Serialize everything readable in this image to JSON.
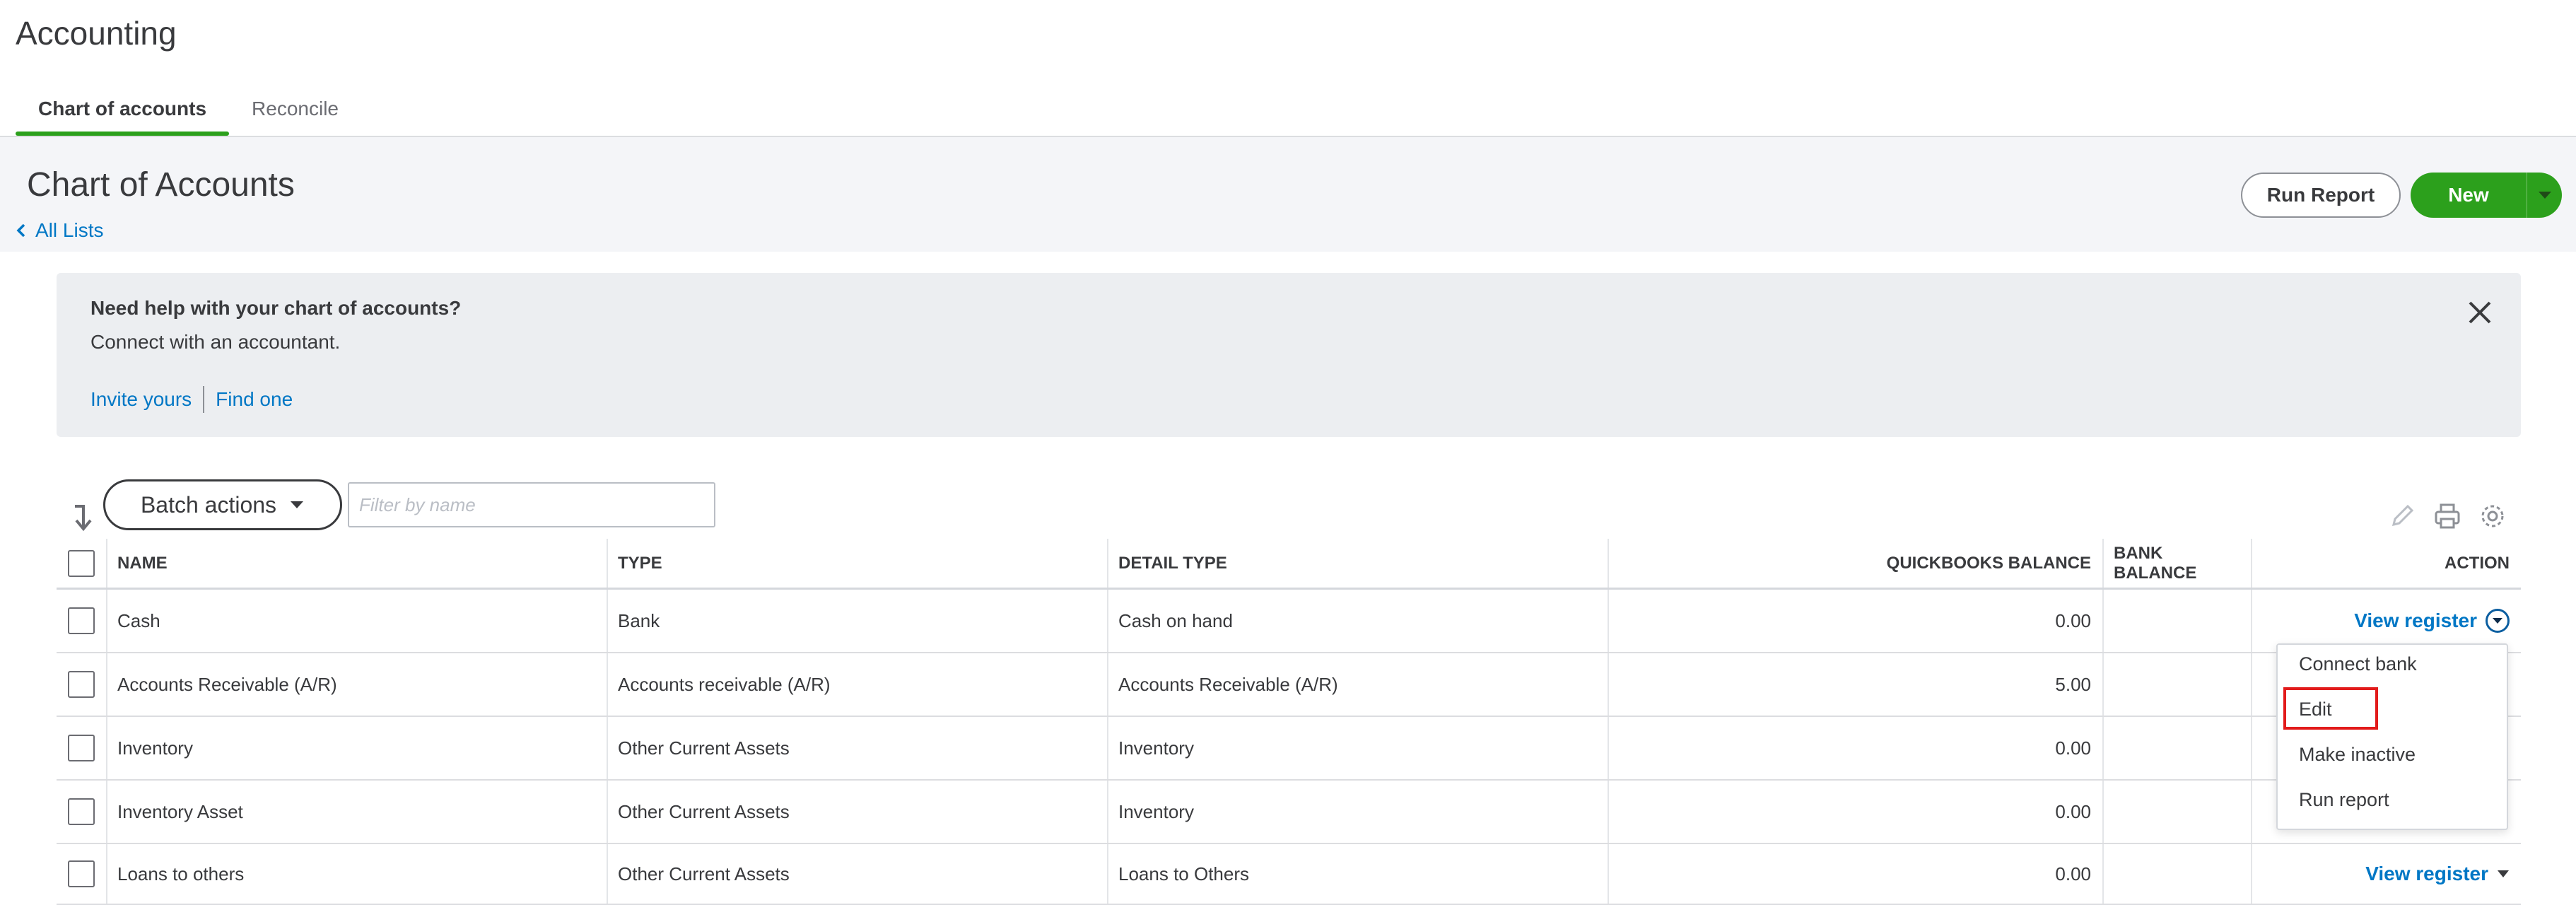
{
  "app": {
    "title": "Accounting"
  },
  "tabs": [
    {
      "label": "Chart of accounts",
      "active": true
    },
    {
      "label": "Reconcile",
      "active": false
    }
  ],
  "header": {
    "title": "Chart of Accounts",
    "back_link": "All Lists",
    "run_report_label": "Run Report",
    "new_label": "New"
  },
  "help": {
    "title": "Need help with your chart of accounts?",
    "subtitle": "Connect with an accountant.",
    "link_invite": "Invite yours",
    "link_find": "Find one"
  },
  "toolbar": {
    "batch_label": "Batch actions",
    "filter_placeholder": "Filter by name"
  },
  "table": {
    "columns": {
      "name": "NAME",
      "type": "TYPE",
      "detail_type": "DETAIL TYPE",
      "qb_balance": "QUICKBOOKS BALANCE",
      "bank_balance": "BANK BALANCE",
      "action": "ACTION"
    },
    "rows": [
      {
        "name": "Cash",
        "type": "Bank",
        "detail": "Cash on hand",
        "qb_balance": "0.00",
        "bank_balance": "",
        "action": "View register"
      },
      {
        "name": "Accounts Receivable (A/R)",
        "type": "Accounts receivable (A/R)",
        "detail": "Accounts Receivable (A/R)",
        "qb_balance": "5.00",
        "bank_balance": "",
        "action": ""
      },
      {
        "name": "Inventory",
        "type": "Other Current Assets",
        "detail": "Inventory",
        "qb_balance": "0.00",
        "bank_balance": "",
        "action": ""
      },
      {
        "name": "Inventory Asset",
        "type": "Other Current Assets",
        "detail": "Inventory",
        "qb_balance": "0.00",
        "bank_balance": "",
        "action": ""
      },
      {
        "name": "Loans to others",
        "type": "Other Current Assets",
        "detail": "Loans to Others",
        "qb_balance": "0.00",
        "bank_balance": "",
        "action": "View register"
      }
    ]
  },
  "dropdown": {
    "items": [
      "Connect bank",
      "Edit",
      "Make inactive",
      "Run report"
    ],
    "highlighted": "Edit"
  },
  "colors": {
    "accent_green": "#2ca01c",
    "link_blue": "#0077c5",
    "highlight_red": "#e21b1b"
  }
}
